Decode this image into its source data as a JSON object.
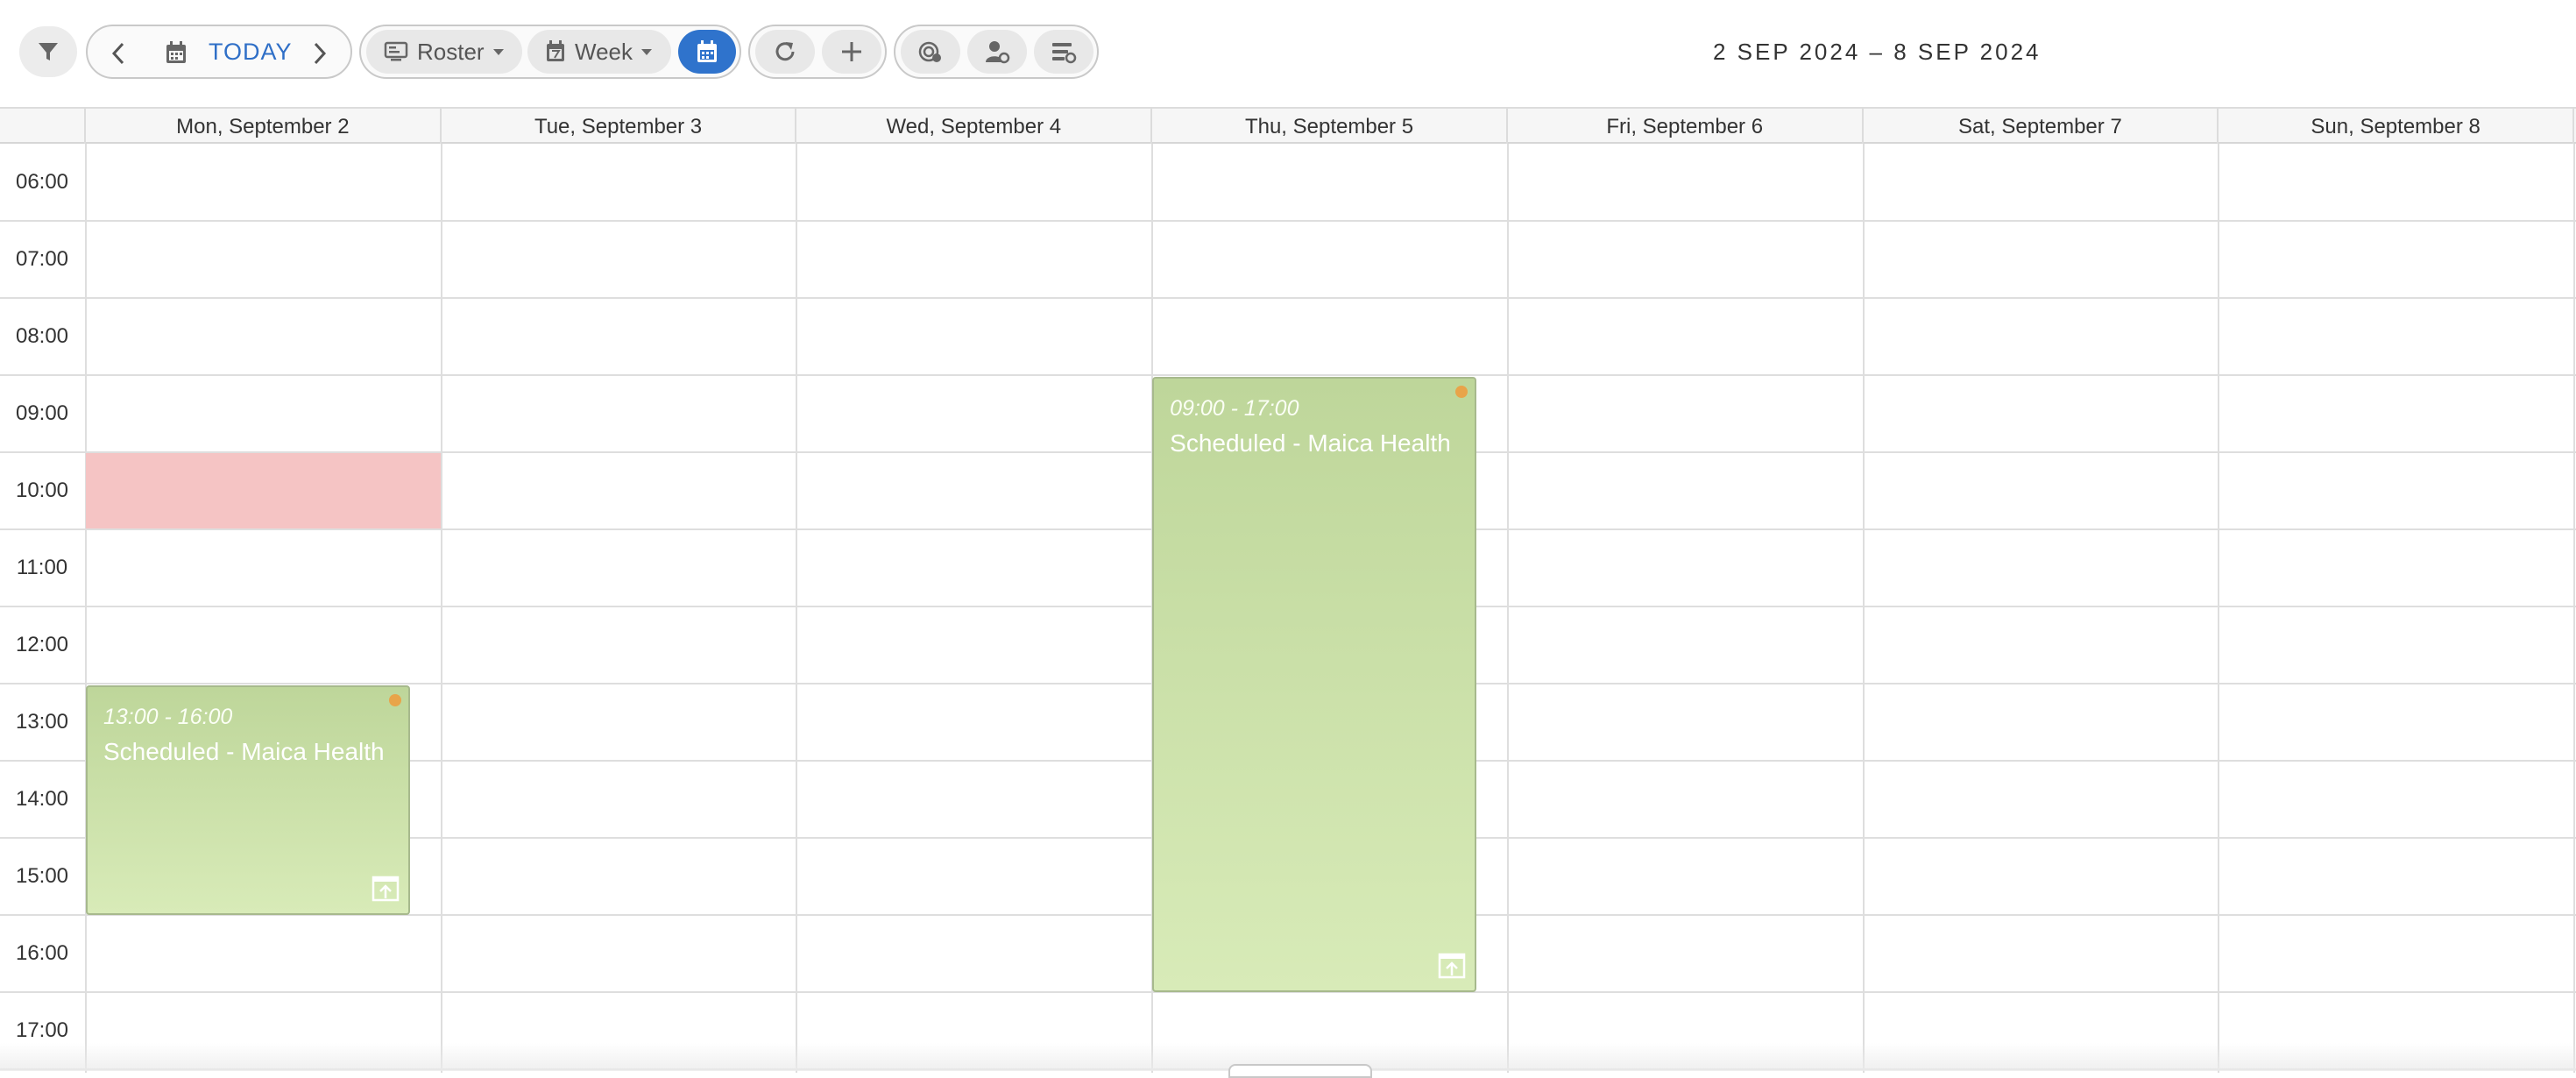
{
  "toolbar": {
    "today_label": "TODAY",
    "view_mode_label": "Roster",
    "period_label": "Week",
    "date_range": "2 SEP 2024 – 8 SEP 2024",
    "icons": {
      "filter": "filter-icon",
      "prev": "chevron-left-icon",
      "calendar": "calendar-icon",
      "next": "chevron-right-icon",
      "roster": "roster-icon",
      "week": "week-calendar-icon",
      "date_picker": "calendar-active-icon",
      "refresh": "refresh-icon",
      "add": "plus-icon",
      "availability": "availability-icon",
      "user_settings": "user-settings-icon",
      "list_settings": "list-settings-icon"
    },
    "accent_color": "#2f73cc"
  },
  "calendar": {
    "days": [
      "Mon, September 2",
      "Tue, September 3",
      "Wed, September 4",
      "Thu, September 5",
      "Fri, September 6",
      "Sat, September 7",
      "Sun, September 8"
    ],
    "hours": [
      "06:00",
      "07:00",
      "08:00",
      "09:00",
      "10:00",
      "11:00",
      "12:00",
      "13:00",
      "14:00",
      "15:00",
      "16:00",
      "17:00"
    ],
    "events": [
      {
        "day": 0,
        "start": "13:00",
        "end": "16:00",
        "time_label": "13:00 - 16:00",
        "title": "Scheduled - Maica Health",
        "color": "#c6dea4"
      },
      {
        "day": 3,
        "start": "09:00",
        "end": "17:00",
        "time_label": "09:00 - 17:00",
        "title": "Scheduled - Maica Health",
        "color": "#c6dea4"
      }
    ],
    "blocked": [
      {
        "day": 0,
        "start": "10:00",
        "end": "11:00",
        "color": "#f5c4c4"
      }
    ],
    "status_dot_color": "#e8a44a"
  }
}
